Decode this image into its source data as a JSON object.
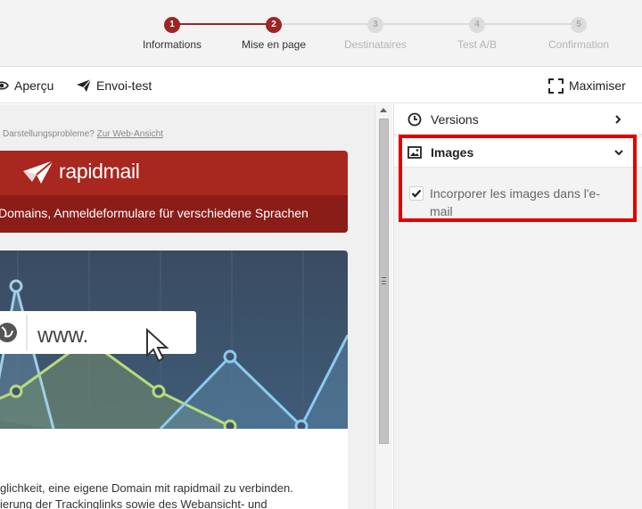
{
  "stepper": {
    "steps": [
      {
        "number": "1",
        "label": "Informations",
        "state": "active"
      },
      {
        "number": "2",
        "label": "Mise en page",
        "state": "active"
      },
      {
        "number": "3",
        "label": "Destinataires",
        "state": "inactive"
      },
      {
        "number": "4",
        "label": "Test A/B",
        "state": "inactive"
      },
      {
        "number": "5",
        "label": "Confirmation",
        "state": "inactive"
      }
    ],
    "active_color": "#9d2525",
    "inactive_color": "#dcdcdc"
  },
  "toolbar": {
    "preview_label": "Aperçu",
    "preview_icon": "eye-icon",
    "test_send_label": "Envoi-test",
    "test_send_icon": "paper-plane-icon",
    "maximize_label": "Maximiser",
    "maximize_icon": "expand-icon"
  },
  "preview": {
    "preheader_text": "Darstellungsprobleme? ",
    "preheader_link": "Zur Web-Ansicht",
    "brand_name": "rapidmail",
    "brand_color": "#a8271f",
    "tagline": "Domains, Anmeldeformulare für verschiedene Sprachen",
    "hero_url_text": "www.",
    "body_line_1": "glichkeit, eine eigene Domain mit rapidmail zu verbinden.",
    "body_line_2": "ierung der Trackinglinks sowie des Webansicht- und"
  },
  "panel": {
    "versions_label": "Versions",
    "versions_icon": "clock-icon",
    "images_label": "Images",
    "images_icon": "image-icon",
    "embed_images_label": "Incorporer les images dans l'e-mail",
    "embed_images_checked": true,
    "highlight_color": "#e00000"
  }
}
